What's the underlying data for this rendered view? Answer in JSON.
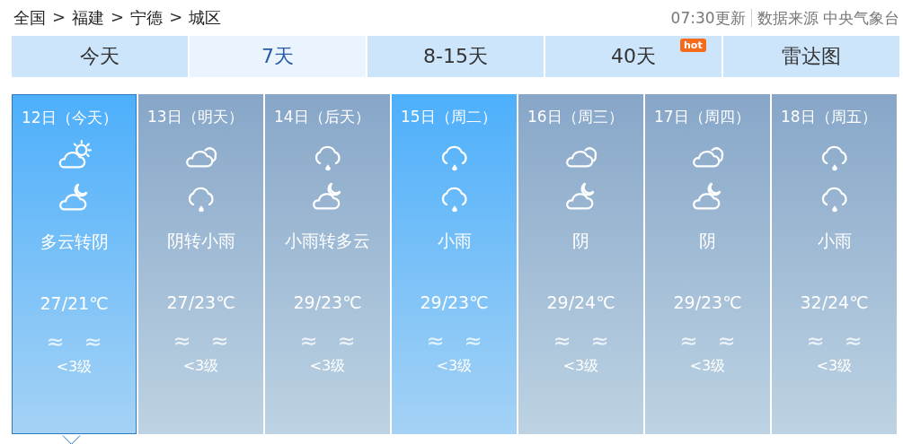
{
  "breadcrumb": {
    "items": [
      "全国",
      "福建",
      "宁德",
      "城区"
    ],
    "separator": ">"
  },
  "update": {
    "time": "07:30更新",
    "source": "数据来源 中央气象台"
  },
  "tabs": [
    {
      "label": "今天",
      "selected": false
    },
    {
      "label": "7天",
      "selected": true
    },
    {
      "label": "8-15天",
      "selected": false
    },
    {
      "label": "40天",
      "selected": false,
      "badge": "hot"
    },
    {
      "label": "雷达图",
      "selected": false
    }
  ],
  "days": [
    {
      "date": "12日（今天）",
      "icons": [
        {
          "kind": "partly_cloudy"
        },
        {
          "kind": "cloudy_night"
        }
      ],
      "weather": "多云转阴",
      "temp": "27/21℃",
      "wind_day": "≈",
      "wind_night": "≈",
      "wind_level": "<3级",
      "highlight": true,
      "selected": true
    },
    {
      "date": "13日（明天）",
      "icons": [
        {
          "kind": "overcast"
        },
        {
          "kind": "rain"
        }
      ],
      "weather": "阴转小雨",
      "temp": "27/23℃",
      "wind_day": "≈",
      "wind_night": "≈",
      "wind_level": "<3级",
      "highlight": false,
      "selected": false
    },
    {
      "date": "14日（后天）",
      "icons": [
        {
          "kind": "rain"
        },
        {
          "kind": "cloudy_night"
        }
      ],
      "weather": "小雨转多云",
      "temp": "29/23℃",
      "wind_day": "≈",
      "wind_night": "≈",
      "wind_level": "<3级",
      "highlight": false,
      "selected": false
    },
    {
      "date": "15日（周二）",
      "icons": [
        {
          "kind": "rain"
        },
        {
          "kind": "rain"
        }
      ],
      "weather": "小雨",
      "temp": "29/23℃",
      "wind_day": "≈",
      "wind_night": "≈",
      "wind_level": "<3级",
      "highlight": true,
      "selected": false
    },
    {
      "date": "16日（周三）",
      "icons": [
        {
          "kind": "overcast"
        },
        {
          "kind": "cloudy_night"
        }
      ],
      "weather": "阴",
      "temp": "29/24℃",
      "wind_day": "≈",
      "wind_night": "≈",
      "wind_level": "<3级",
      "highlight": false,
      "selected": false
    },
    {
      "date": "17日（周四）",
      "icons": [
        {
          "kind": "overcast"
        },
        {
          "kind": "cloudy_night"
        }
      ],
      "weather": "阴",
      "temp": "29/23℃",
      "wind_day": "≈",
      "wind_night": "≈",
      "wind_level": "<3级",
      "highlight": false,
      "selected": false
    },
    {
      "date": "18日（周五）",
      "icons": [
        {
          "kind": "rain"
        },
        {
          "kind": "rain"
        }
      ],
      "weather": "小雨",
      "temp": "32/24℃",
      "wind_day": "≈",
      "wind_night": "≈",
      "wind_level": "<3级",
      "highlight": false,
      "selected": false
    }
  ]
}
